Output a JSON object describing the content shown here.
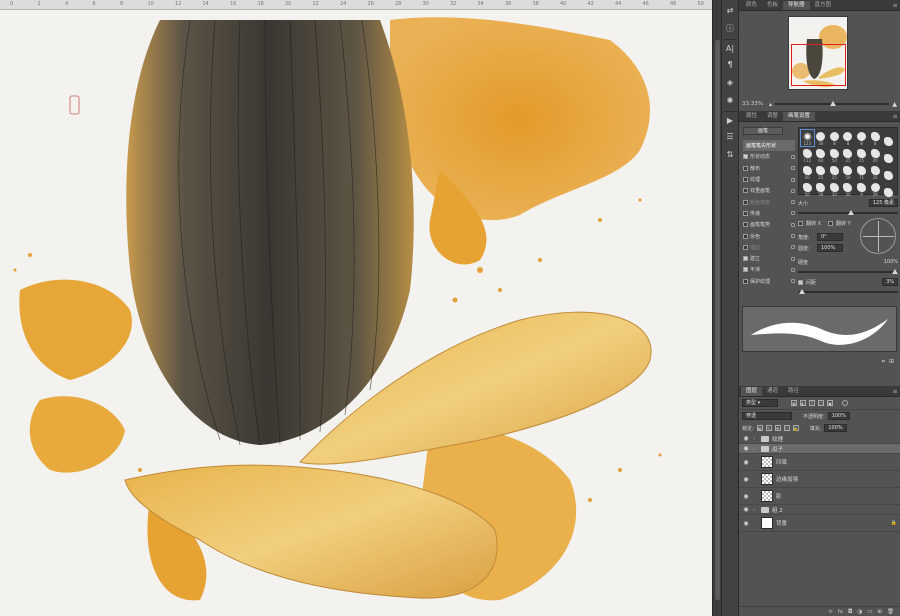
{
  "canvas": {
    "ruler_marks": [
      "0",
      "2",
      "4",
      "6",
      "8",
      "10",
      "12",
      "14",
      "16",
      "18",
      "20",
      "22",
      "24",
      "26",
      "28",
      "30",
      "32",
      "34",
      "36",
      "38",
      "40",
      "42",
      "44",
      "46",
      "48",
      "50"
    ]
  },
  "toolbar": {
    "icons": [
      "expand-icon",
      "info-icon",
      "character-icon",
      "3d-icon",
      "properties-icon",
      "actions-icon",
      "adjust-icon"
    ]
  },
  "panels": {
    "top_tabs": [
      "颜色",
      "色板",
      "导航器",
      "直方图"
    ],
    "top_tabs_active": 2,
    "zoom_value": "33.33%",
    "zoom_level": 0.48,
    "mid_tabs": [
      "属性",
      "调整",
      "画笔设置"
    ],
    "mid_tabs_active": 2
  },
  "brush": {
    "preset_label": "画笔",
    "options": [
      {
        "label": "画笔笔尖形状",
        "checked": null,
        "header": true
      },
      {
        "label": "形状动态",
        "checked": true
      },
      {
        "label": "散布",
        "checked": false
      },
      {
        "label": "纹理",
        "checked": false
      },
      {
        "label": "双重画笔",
        "checked": false
      },
      {
        "label": "颜色动态",
        "checked": false,
        "dim": true
      },
      {
        "label": "传递",
        "checked": false
      },
      {
        "label": "画笔笔势",
        "checked": false
      },
      {
        "label": "杂色",
        "checked": false
      },
      {
        "label": "湿边",
        "checked": false,
        "dim": true
      },
      {
        "label": "建立",
        "checked": true
      },
      {
        "label": "平滑",
        "checked": true
      },
      {
        "label": "保护纹理",
        "checked": false
      }
    ],
    "tips": [
      {
        "size": "123",
        "kind": "soft"
      },
      {
        "size": "30",
        "kind": "solid"
      },
      {
        "size": "8",
        "kind": "solid"
      },
      {
        "size": "8",
        "kind": "solid"
      },
      {
        "size": "8",
        "kind": "solid"
      },
      {
        "size": "8",
        "kind": "blot"
      },
      {
        "size": "",
        "kind": "blot"
      },
      {
        "size": "112",
        "kind": "blot"
      },
      {
        "size": "60",
        "kind": "blot"
      },
      {
        "size": "50",
        "kind": "blot"
      },
      {
        "size": "25",
        "kind": "blot"
      },
      {
        "size": "25",
        "kind": "blot"
      },
      {
        "size": "20",
        "kind": "blot"
      },
      {
        "size": "",
        "kind": "blot"
      },
      {
        "size": "50",
        "kind": "blot"
      },
      {
        "size": "25",
        "kind": "blot"
      },
      {
        "size": "25",
        "kind": "blot"
      },
      {
        "size": "50",
        "kind": "blot"
      },
      {
        "size": "71",
        "kind": "blot"
      },
      {
        "size": "25",
        "kind": "blot"
      },
      {
        "size": "",
        "kind": "blot"
      },
      {
        "size": "50",
        "kind": "blot"
      },
      {
        "size": "36",
        "kind": "blot"
      },
      {
        "size": "30",
        "kind": "blot"
      },
      {
        "size": "30",
        "kind": "blot"
      },
      {
        "size": "9",
        "kind": "blot"
      },
      {
        "size": "39",
        "kind": "solid"
      },
      {
        "size": "",
        "kind": "blot"
      }
    ],
    "size_label": "大小",
    "size_value": "125 像素",
    "flip_x_label": "翻转 X",
    "flip_y_label": "翻转 Y",
    "angle_label": "角度:",
    "angle_value": "0°",
    "roundness_label": "圆度:",
    "roundness_value": "100%",
    "hardness_label": "硬度",
    "hardness_value": "100%",
    "spacing_label": "间距",
    "spacing_value": "3%",
    "spacing_checked": true
  },
  "layers": {
    "tabs": [
      "图层",
      "通道",
      "路径"
    ],
    "tabs_active": 0,
    "filter_label": "类型",
    "blend_mode": "穿透",
    "opacity_label": "不透明度:",
    "opacity_value": "100%",
    "lock_label": "锁定:",
    "fill_label": "填充:",
    "fill_value": "100%",
    "items": [
      {
        "name": "纹理",
        "type": "group",
        "selected": false
      },
      {
        "name": "瓜子",
        "type": "group",
        "selected": true
      },
      {
        "name": "印章",
        "type": "layer",
        "thumb": "checker"
      },
      {
        "name": "边缘加强",
        "type": "layer",
        "thumb": "checker"
      },
      {
        "name": "影",
        "type": "layer",
        "thumb": "checker"
      },
      {
        "name": "组 2",
        "type": "group",
        "selected": false
      },
      {
        "name": "背景",
        "type": "layer",
        "thumb": "white",
        "locked": true
      }
    ],
    "bottom_icons": [
      "link-icon",
      "fx-icon",
      "mask-icon",
      "adjustment-icon",
      "folder-icon",
      "new-layer-icon",
      "trash-icon"
    ]
  }
}
